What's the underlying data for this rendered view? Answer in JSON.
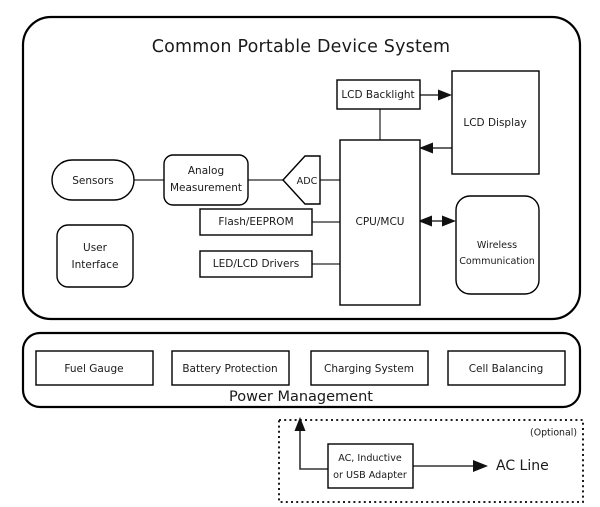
{
  "diagram": {
    "title": "Common Portable Device System",
    "type": "block-diagram",
    "sections": {
      "system": {
        "title": "Common Portable Device System",
        "blocks": [
          {
            "id": "sensors",
            "label": "Sensors",
            "shape": "stadium"
          },
          {
            "id": "user-interface",
            "label_line1": "User",
            "label_line2": "Interface",
            "shape": "rounded-rect"
          },
          {
            "id": "analog-measurement",
            "label_line1": "Analog",
            "label_line2": "Measurement",
            "shape": "rounded-rect"
          },
          {
            "id": "adc",
            "label": "ADC",
            "shape": "pentagon-funnel"
          },
          {
            "id": "flash-eeprom",
            "label": "Flash/EEPROM",
            "shape": "rect"
          },
          {
            "id": "led-lcd-drivers",
            "label": "LED/LCD Drivers",
            "shape": "rect"
          },
          {
            "id": "cpu-mcu",
            "label": "CPU/MCU",
            "shape": "rect"
          },
          {
            "id": "lcd-backlight",
            "label": "LCD Backlight",
            "shape": "rect"
          },
          {
            "id": "lcd-display",
            "label": "LCD Display",
            "shape": "rect"
          },
          {
            "id": "wireless-communication",
            "label_line1": "Wireless",
            "label_line2": "Communication",
            "shape": "rounded-rect"
          }
        ]
      },
      "power": {
        "title": "Power Management",
        "blocks": [
          {
            "id": "fuel-gauge",
            "label": "Fuel Gauge"
          },
          {
            "id": "battery-protection",
            "label": "Battery Protection"
          },
          {
            "id": "charging-system",
            "label": "Charging System"
          },
          {
            "id": "cell-balancing",
            "label": "Cell Balancing"
          }
        ]
      },
      "optional": {
        "badge": "(Optional)",
        "adapter_line1": "AC, Inductive",
        "adapter_line2": "or USB Adapter",
        "ac_line": "AC Line"
      }
    },
    "connections": [
      {
        "from": "sensors",
        "to": "analog-measurement",
        "arrow": "none"
      },
      {
        "from": "analog-measurement",
        "to": "adc",
        "arrow": "none"
      },
      {
        "from": "adc",
        "to": "cpu-mcu",
        "arrow": "none"
      },
      {
        "from": "flash-eeprom",
        "to": "cpu-mcu",
        "arrow": "none"
      },
      {
        "from": "led-lcd-drivers",
        "to": "cpu-mcu",
        "arrow": "none"
      },
      {
        "from": "cpu-mcu",
        "to": "lcd-backlight",
        "arrow": "none"
      },
      {
        "from": "lcd-backlight",
        "to": "lcd-display",
        "arrow": "right"
      },
      {
        "from": "lcd-display",
        "to": "cpu-mcu",
        "arrow": "left"
      },
      {
        "from": "cpu-mcu",
        "to": "wireless-communication",
        "arrow": "both"
      },
      {
        "from": "adapter",
        "to": "power-management",
        "arrow": "up"
      },
      {
        "from": "adapter",
        "to": "ac-line",
        "arrow": "right"
      }
    ],
    "colors": {
      "stroke": "#000000",
      "wire": "#4a4a4a",
      "fill": "#ffffff",
      "text": "#1a1a1a"
    }
  }
}
